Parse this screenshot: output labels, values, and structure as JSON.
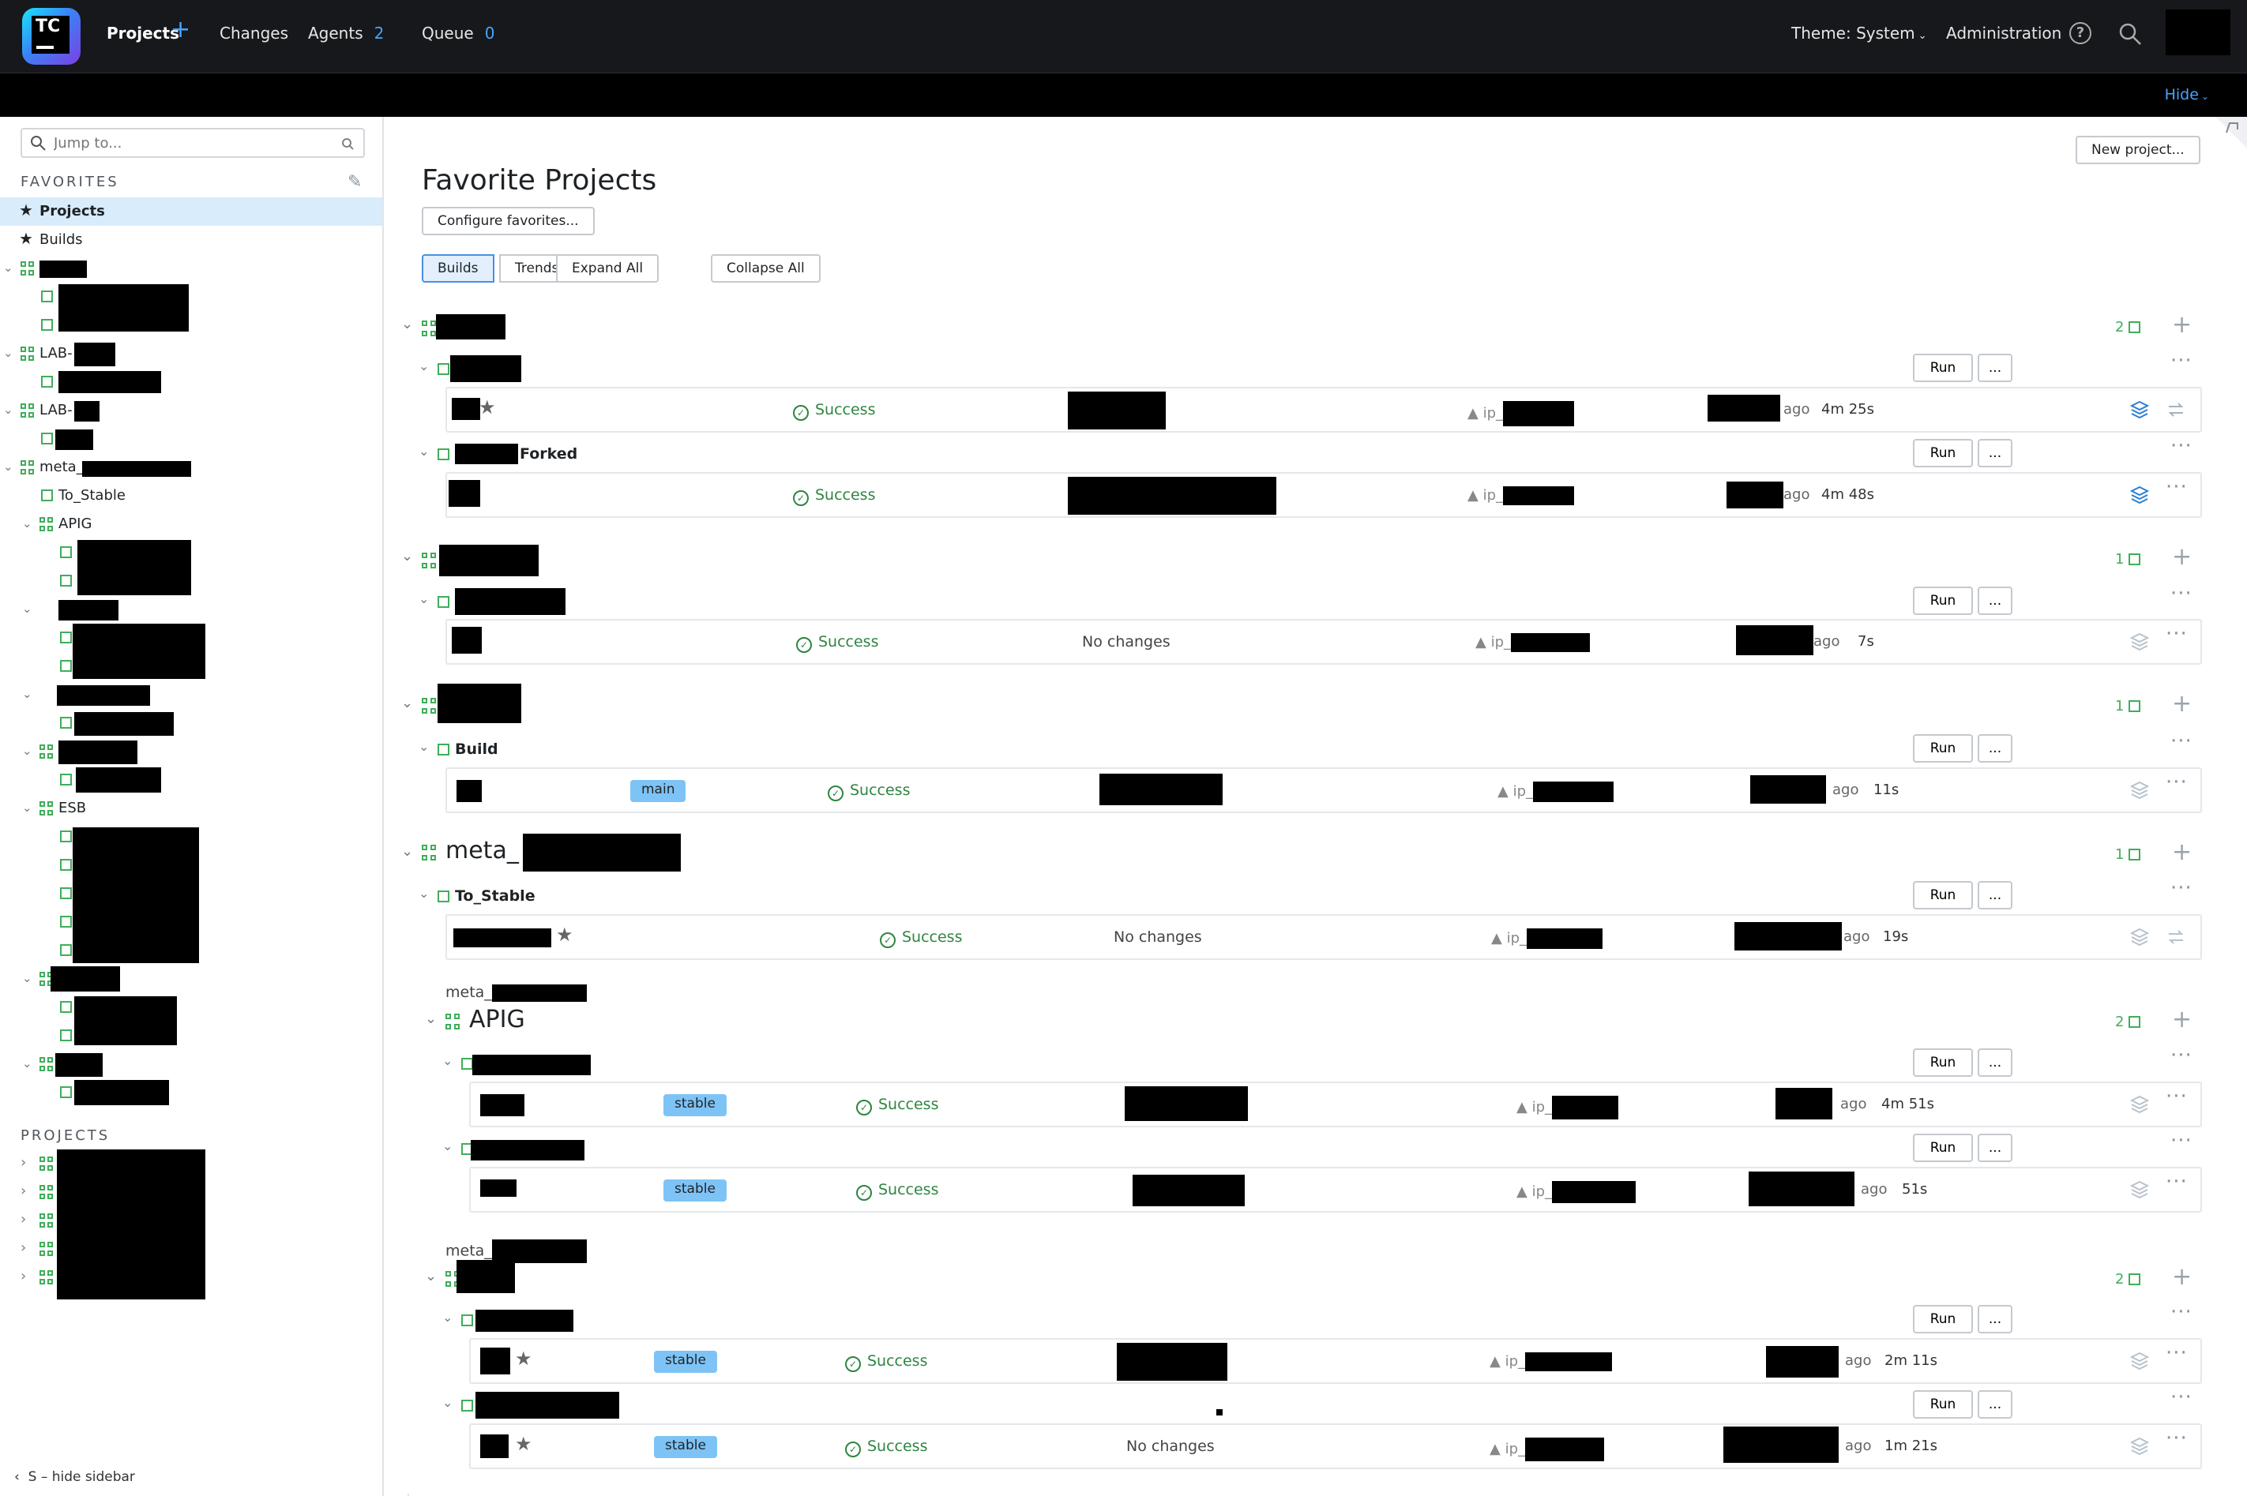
{
  "app": {
    "logo_text": "TC"
  },
  "header": {
    "nav": [
      {
        "label": "Projects",
        "count": ""
      },
      {
        "label": "Changes",
        "count": ""
      },
      {
        "label": "Agents",
        "count": "2"
      },
      {
        "label": "Queue",
        "count": "0"
      }
    ],
    "theme": "Theme: System",
    "administration": "Administration",
    "hide": "Hide"
  },
  "sidebar": {
    "search_placeholder": "Jump to...",
    "favorites_heading": "FAVORITES",
    "projects_heading": "PROJECTS",
    "fav_items": [
      "Projects",
      "Builds"
    ],
    "tree_labels": {
      "lab1": "LAB-",
      "lab2": "LAB-",
      "meta": "meta_",
      "to_stable": "To_Stable",
      "apig": "APIG",
      "esb": "ESB"
    },
    "hide_sidebar": "S – hide sidebar"
  },
  "main": {
    "title": "Favorite Projects",
    "new_project": "New project...",
    "configure_favorites": "Configure favorites...",
    "view_tabs": [
      "Builds",
      "Trends"
    ],
    "expand_all": "Expand All",
    "collapse_all": "Collapse All",
    "run_label": "Run",
    "more_label": "...",
    "status_success": "Success",
    "no_changes": "No changes",
    "agent_prefix": "ip_",
    "ago": "ago",
    "projects": [
      {
        "name": "",
        "count": "2",
        "builds": [
          {
            "name": "",
            "status": "Success",
            "duration": "4m 25s"
          },
          {
            "name": "Forked",
            "status": "Success",
            "duration": "4m 48s"
          }
        ]
      },
      {
        "name": "",
        "count": "1",
        "builds": [
          {
            "name": "",
            "status": "Success",
            "changes": "No changes",
            "duration": "7s"
          }
        ]
      },
      {
        "name": "",
        "count": "1",
        "builds": [
          {
            "name": "Build",
            "branch": "main",
            "status": "Success",
            "duration": "11s"
          }
        ]
      },
      {
        "name": "meta_",
        "count": "1",
        "builds": [
          {
            "name": "To_Stable",
            "status": "Success",
            "changes": "No changes",
            "duration": "19s"
          }
        ]
      },
      {
        "name": "APIG",
        "parent": "meta_",
        "count": "2",
        "builds": [
          {
            "name": "",
            "branch": "stable",
            "status": "Success",
            "duration": "4m 51s"
          },
          {
            "name": "",
            "branch": "stable",
            "status": "Success",
            "duration": "51s"
          }
        ]
      },
      {
        "name": "",
        "parent": "meta_",
        "count": "2",
        "builds": [
          {
            "name": "",
            "branch": "stable",
            "status": "Success",
            "duration": "2m 11s"
          },
          {
            "name": "",
            "branch": "stable",
            "status": "Success",
            "changes": "No changes",
            "duration": "1m 21s"
          }
        ]
      }
    ]
  }
}
